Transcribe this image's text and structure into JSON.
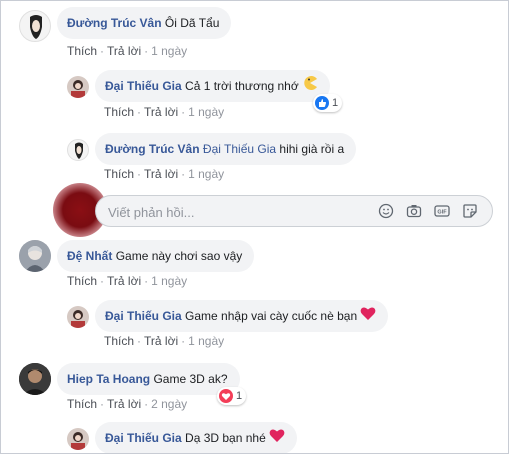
{
  "comments": [
    {
      "name": "Đường Trúc Vân",
      "text": "Ôi Dã Tẩu",
      "like": "Thích",
      "reply": "Trả lời",
      "time": "1 ngày"
    },
    {
      "name": "Đại Thiếu Gia",
      "text": "Cả 1 trời thương nhớ",
      "like": "Thích",
      "reply": "Trả lời",
      "time": "1 ngày",
      "reaction_count": "1"
    },
    {
      "name": "Đường Trúc Vân",
      "mention": "Đại Thiếu Gia",
      "text": "hihi già rồi a",
      "like": "Thích",
      "reply": "Trả lời",
      "time": "1 ngày"
    },
    {
      "name": "Đệ Nhất",
      "text": "Game này chơi sao vậy",
      "like": "Thích",
      "reply": "Trả lời",
      "time": "1 ngày"
    },
    {
      "name": "Đại Thiếu Gia",
      "text": "Game nhập vai cày cuốc nè bạn",
      "like": "Thích",
      "reply": "Trả lời",
      "time": "1 ngày"
    },
    {
      "name": "Hiep Ta Hoang",
      "text": "Game 3D ak?",
      "like": "Thích",
      "reply": "Trả lời",
      "time": "2 ngày",
      "reaction_count": "1"
    },
    {
      "name": "Đại Thiếu Gia",
      "text": "Dạ 3D bạn nhé"
    }
  ],
  "reply_box": {
    "placeholder": "Viết phản hồi..."
  },
  "separator": "·",
  "icons": {
    "emoji": "smile-icon",
    "camera": "camera-icon",
    "gif": "gif-icon",
    "sticker": "sticker-icon",
    "heart": "heart-icon",
    "pacman": "pacman-emoji-icon"
  },
  "colors": {
    "name": "#385898",
    "bubble": "#f2f3f5",
    "meta": "#90949c",
    "like_blue": "#1877f2",
    "love_red": "#f33e58"
  }
}
